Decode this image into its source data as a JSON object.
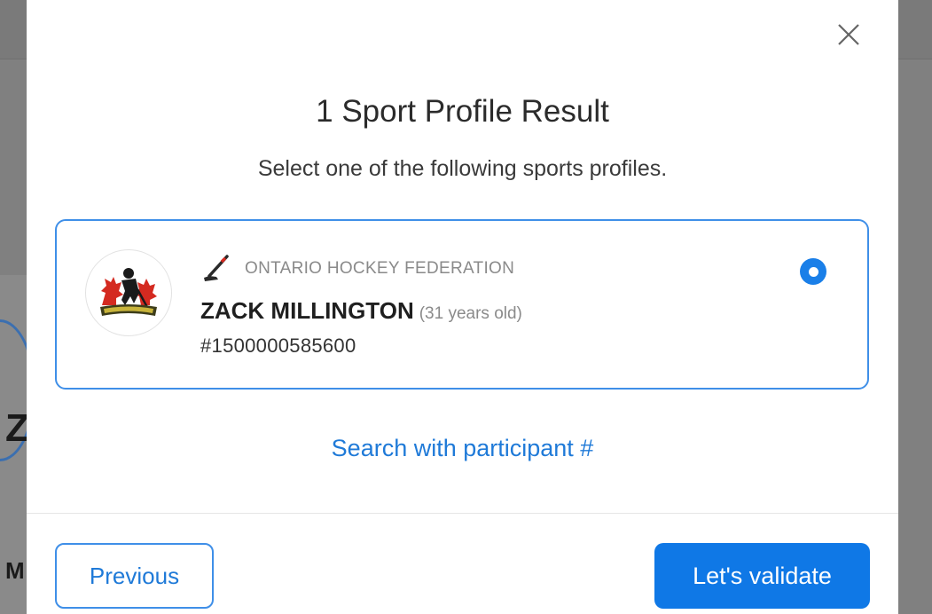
{
  "modal": {
    "title": "1 Sport Profile Result",
    "subtitle": "Select one of the following sports profiles.",
    "close_icon": "close-icon"
  },
  "profile": {
    "organization": "ONTARIO HOCKEY FEDERATION",
    "sport_icon": "hockey-stick-icon",
    "name": "ZACK MILLINGTON",
    "age": "(31 years old)",
    "number": "#1500000585600",
    "selected": true
  },
  "links": {
    "search_participant": "Search with participant #"
  },
  "footer": {
    "previous_label": "Previous",
    "validate_label": "Let's validate"
  },
  "background": {
    "partial_letter_1": "Z",
    "partial_letter_2": "M"
  },
  "colors": {
    "accent": "#0f78e6",
    "link": "#1f7ad8",
    "card_border": "#3f8fe8",
    "muted_text": "#8a8a8a"
  }
}
